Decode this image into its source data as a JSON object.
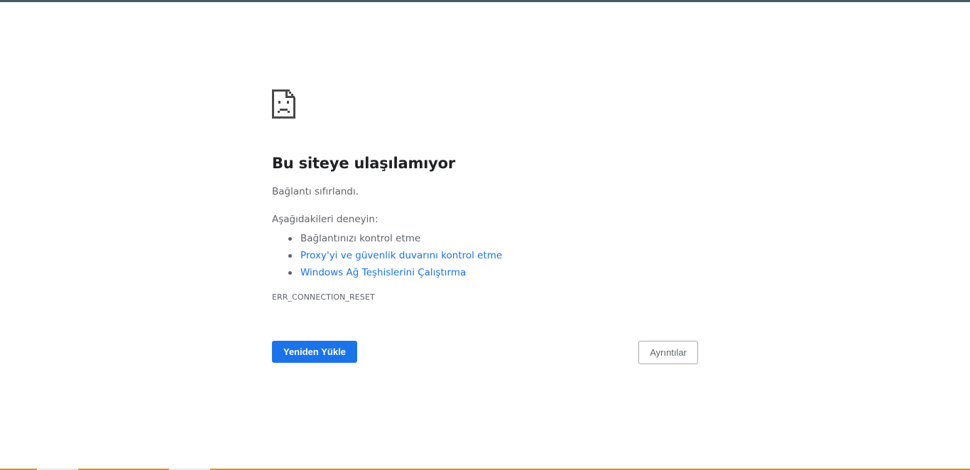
{
  "error": {
    "title": "Bu siteye ulaşılamıyor",
    "subtitle": "Bağlantı sıfırlandı.",
    "suggestions_heading": "Aşağıdakileri deneyin:",
    "suggestions": [
      {
        "label": "Bağlantınızı kontrol etme",
        "link": false
      },
      {
        "label": "Proxy'yi ve güvenlik duvarını kontrol etme",
        "link": true
      },
      {
        "label": "Windows Ağ Teşhislerini Çalıştırma",
        "link": true
      }
    ],
    "code": "ERR_CONNECTION_RESET"
  },
  "buttons": {
    "reload_label": "Yeniden Yükle",
    "details_label": "Ayrıntılar"
  },
  "colors": {
    "accent": "#1a73e8",
    "text_primary": "#202124",
    "text_secondary": "#5f6368"
  },
  "icons": {
    "error": "sad-page-icon"
  }
}
